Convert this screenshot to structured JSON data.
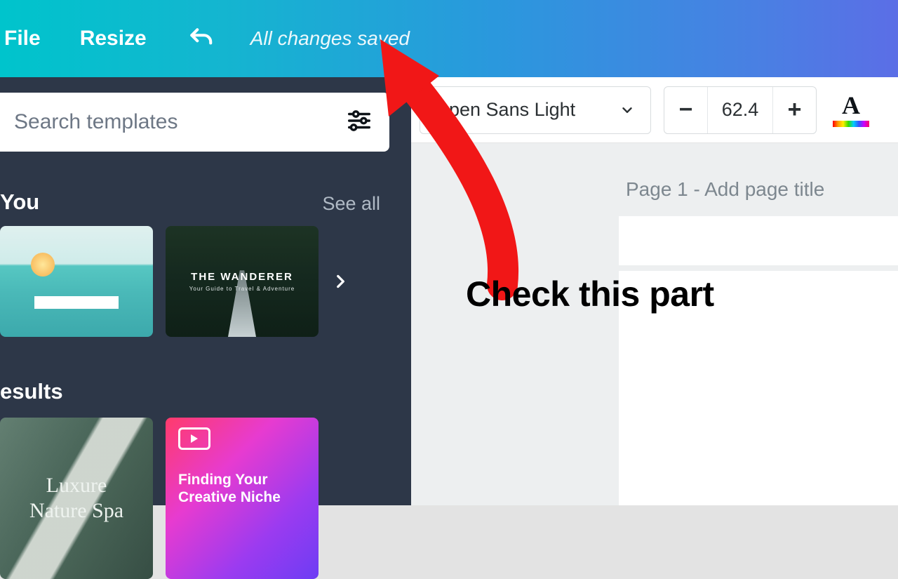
{
  "topbar": {
    "file_label": "File",
    "resize_label": "Resize",
    "saved_status": "All changes saved"
  },
  "sidebar": {
    "search_placeholder": "Search templates",
    "sections": {
      "for_you": {
        "heading": "You",
        "see_all": "See all"
      },
      "results": {
        "heading": "esults"
      }
    },
    "templates": {
      "wanderer": {
        "title": "THE WANDERER",
        "subtitle": "Your Guide to Travel & Adventure"
      },
      "spa": {
        "line1": "Luxure",
        "line2": "Nature Spa"
      },
      "gradient": {
        "text": "Finding Your Creative Niche"
      }
    }
  },
  "toolbar": {
    "font_name": "Open Sans Light",
    "font_size": "62.4",
    "minus": "−",
    "plus": "+",
    "colorA": "A"
  },
  "canvas": {
    "page_prefix": "Page 1",
    "page_title_hint": " - Add page title"
  },
  "annotation": {
    "text": "Check this part"
  }
}
